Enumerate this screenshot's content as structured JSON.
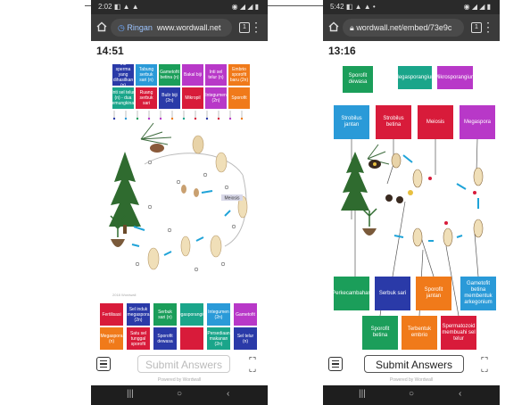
{
  "caption": "",
  "colors": {
    "red": "#d81b3a",
    "green": "#1b9e5a",
    "blue": "#1f5fb8",
    "orange": "#f07a1a",
    "magenta": "#b838c8",
    "navy": "#2a3aa8",
    "cyan": "#2a9ad8",
    "teal": "#1aa58a"
  },
  "left": {
    "status": {
      "time": "2:02",
      "icons_left": "◧ ▲ ▲",
      "icons_right": "◉ ◢ ◢ ▮"
    },
    "url": {
      "text": "www.wordwall.net",
      "app_label": "Ringan"
    },
    "timer": "14:51",
    "top_labels": [
      "Inti sperma yang dihasilkan (n)",
      "Tabung serbuk sari (n)",
      "Gametofit betina (n)",
      "Bakal biji",
      "Inti sel telur (n)",
      "Embrio sporofit baru (2n)",
      "Inti sel telur (n) - dua kemungkinan",
      "Ruang serbuk sari",
      "Bulir biji (2n)",
      "Mikropil",
      "Integumen (2n)",
      "Sporofit"
    ],
    "bottom_labels": [
      "Fertilisasi",
      "Sel induk megaspora (2n)",
      "Serbuk sari (n)",
      "Megasporangium",
      "Integumen (2n)",
      "Gametofit",
      "Megaspora (n)",
      "Satu sel tunggal sporofit",
      "Sporofit dewasa",
      "",
      "Persediaan makanan (2n)",
      "Sel telur (n)"
    ],
    "diagram_label": "Meiosis",
    "credit": "2018 Wordwall",
    "submit": "Submit Answers",
    "powered": "Powered by Wordwall"
  },
  "right": {
    "status": {
      "time": "5:42",
      "icons_left": "◧ ▲ ▲ •",
      "icons_right": "◉ ◢ ◢ ▮"
    },
    "url": {
      "text": "wordwall.net/embed/73e9c"
    },
    "timer": "13:16",
    "pool_labels": [
      "Sporofit dewasa",
      "Megasporangium",
      "Mikrosporangium"
    ],
    "side_labels": [
      "Strobilus jantan",
      "Strobilus betina",
      "Meiosis",
      "Megaspora"
    ],
    "bottom_labels": [
      "Perkecambahan",
      "Serbuk sari",
      "Sporofit jantan",
      "Gametofit betina membentuk arkegonium",
      "Sporofit betina",
      "Terbentuk embrio",
      "Spermatozoid membuahi sel telur"
    ],
    "submit": "Submit Answers",
    "powered": "Powered by Wordwall"
  },
  "navbar": {
    "recent": "|||",
    "home": "○",
    "back": "‹"
  }
}
